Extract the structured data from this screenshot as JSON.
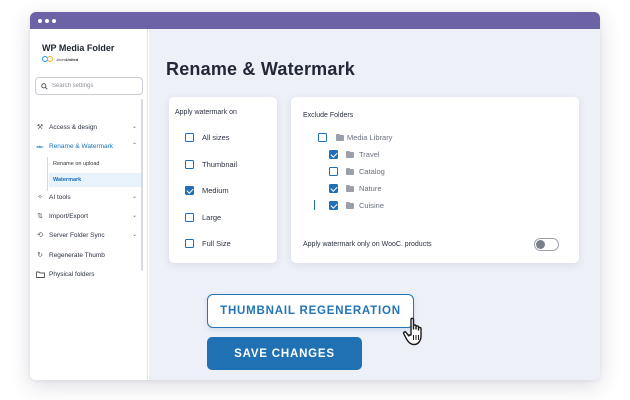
{
  "brand": {
    "title": "WP Media Folder",
    "sub_prefix": "Joom",
    "sub_bold": "United"
  },
  "search": {
    "placeholder": "Search settings"
  },
  "sidebar": {
    "items": [
      {
        "label": "Access & design",
        "icon": "paint-icon"
      },
      {
        "label": "Rename & Watermark",
        "icon": "abc-icon",
        "active": true
      },
      {
        "label": "AI tools",
        "icon": "sparkle-icon"
      },
      {
        "label": "Import/Export",
        "icon": "import-export-icon"
      },
      {
        "label": "Server Folder Sync",
        "icon": "sync-icon"
      },
      {
        "label": "Regenerate Thumb",
        "icon": "refresh-icon"
      },
      {
        "label": "Physical folders",
        "icon": "folder-icon"
      }
    ],
    "sub_items": [
      {
        "label": "Rename on upload"
      },
      {
        "label": "Watermark",
        "selected": true
      }
    ]
  },
  "main": {
    "title": "Rename & Watermark",
    "apply_watermark": {
      "title": "Apply watermark on",
      "options": [
        {
          "label": "All sizes",
          "checked": false
        },
        {
          "label": "Thumbnail",
          "checked": false
        },
        {
          "label": "Medium",
          "checked": true
        },
        {
          "label": "Large",
          "checked": false
        },
        {
          "label": "Full Size",
          "checked": false
        }
      ]
    },
    "exclude_folders": {
      "title": "Exclude Folders",
      "folders": [
        {
          "label": "Media Library",
          "checked": false
        },
        {
          "label": "Travel",
          "checked": true
        },
        {
          "label": "Catalog",
          "checked": false
        },
        {
          "label": "Nature",
          "checked": true
        },
        {
          "label": "Cuisine",
          "checked": true
        }
      ],
      "wooc_label": "Apply watermark only on WooC. products",
      "wooc_enabled": false
    },
    "buttons": {
      "regenerate": "THUMBNAIL REGENERATION",
      "save": "SAVE CHANGES"
    }
  },
  "colors": {
    "titlebar": "#6c63a6",
    "accent": "#1f71b3",
    "main_bg": "#eef0f8"
  }
}
